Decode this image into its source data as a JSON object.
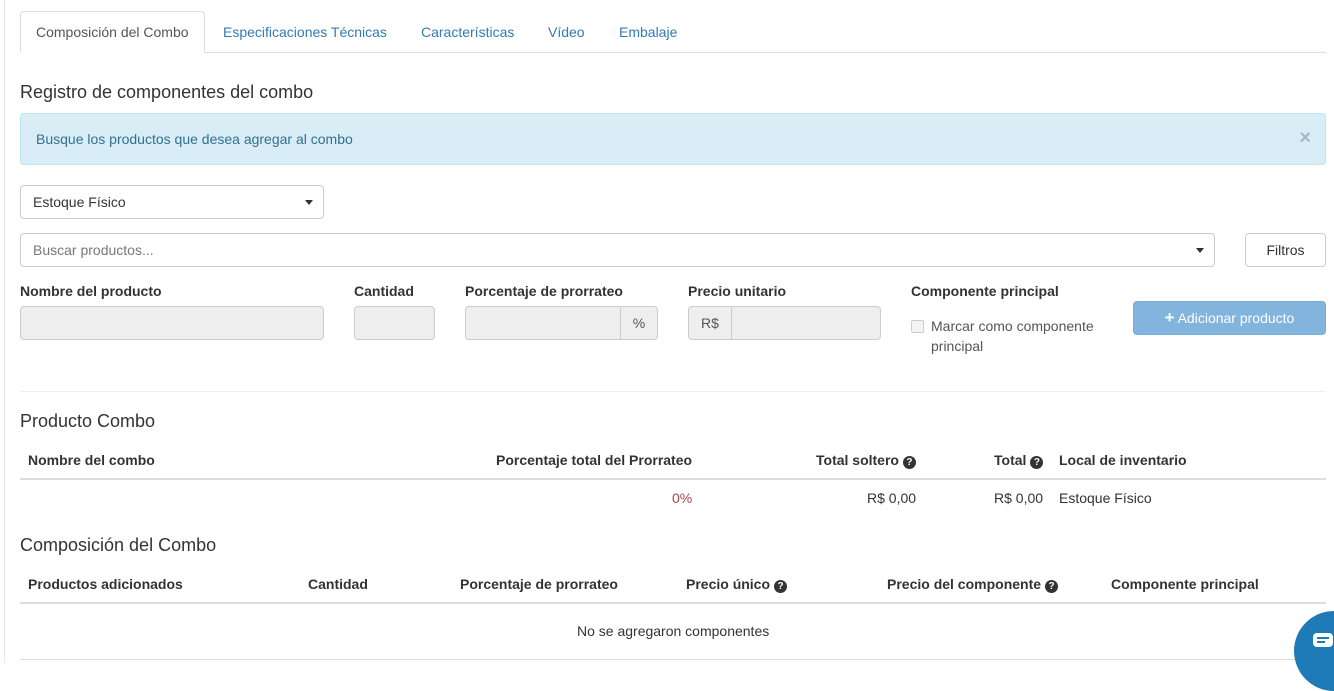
{
  "tabs": [
    {
      "label": "Composición del Combo",
      "active": true
    },
    {
      "label": "Especificaciones Técnicas",
      "active": false
    },
    {
      "label": "Características",
      "active": false
    },
    {
      "label": "Vídeo",
      "active": false
    },
    {
      "label": "Embalaje",
      "active": false
    }
  ],
  "registro": {
    "title": "Registro de componentes del combo",
    "alert": "Busque los productos que desea agregar al combo",
    "alert_close": "×",
    "stock_select": "Estoque Físico",
    "search_placeholder": "Buscar productos...",
    "filters_button": "Filtros"
  },
  "form": {
    "product_name_label": "Nombre del producto",
    "quantity_label": "Cantidad",
    "proration_label": "Porcentaje de prorrateo",
    "percent_addon": "%",
    "unit_price_label": "Precio unitario",
    "currency_addon": "R$",
    "main_component_label": "Componente principal",
    "main_component_checkbox": "Marcar como componente principal",
    "add_button": "Adicionar producto",
    "add_button_icon": "+"
  },
  "producto_combo": {
    "title": "Producto Combo",
    "headers": {
      "name": "Nombre del combo",
      "total_proration": "Porcentaje total del Prorrateo",
      "total_single": "Total soltero",
      "total": "Total",
      "location": "Local de inventario"
    },
    "row": {
      "name": "",
      "total_proration": "0%",
      "total_single": "R$ 0,00",
      "total": "R$ 0,00",
      "location": "Estoque Físico"
    }
  },
  "composicion": {
    "title": "Composición del Combo",
    "headers": {
      "products": "Productos adicionados",
      "quantity": "Cantidad",
      "proration": "Porcentaje de prorrateo",
      "unit_price": "Precio único",
      "component_price": "Precio del componente",
      "main_component": "Componente principal"
    },
    "empty_message": "No se agregaron componentes"
  },
  "icons": {
    "help": "question-circle-icon",
    "chat": "chat-widget-icon",
    "close": "close-icon",
    "dropdown": "caret-down-icon",
    "add": "plus-icon"
  },
  "colors": {
    "link": "#337ab7",
    "alert_bg": "#d9edf7",
    "alert_text": "#31708f",
    "primary_button": "#82b4de",
    "danger_text": "#a94442",
    "chat_widget": "#1f7ab8"
  }
}
